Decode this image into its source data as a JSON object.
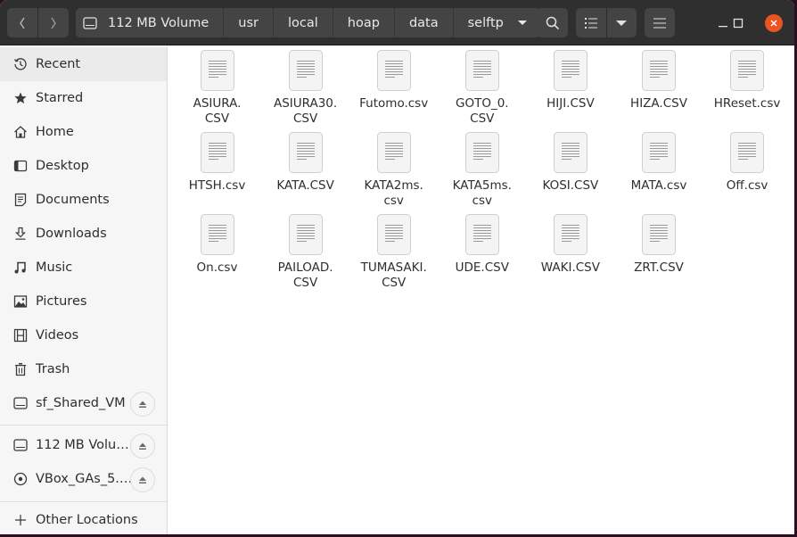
{
  "window": {
    "title": "selftp",
    "controls": {
      "minimize": "minimize",
      "maximize": "maximize",
      "close": "close"
    },
    "accent_color": "#e95420"
  },
  "toolbar": {
    "back_icon": "chevron-left-icon",
    "forward_icon": "chevron-right-icon",
    "breadcrumbs": [
      {
        "label": "112 MB Volume",
        "icon": "drive-icon"
      },
      {
        "label": "usr"
      },
      {
        "label": "local"
      },
      {
        "label": "hoap"
      },
      {
        "label": "data"
      },
      {
        "label": "selftp",
        "has_dropdown": true
      }
    ],
    "search_icon": "search-icon",
    "view_icon": "list-view-icon",
    "view_options_icon": "chevron-down-icon",
    "menu_icon": "hamburger-menu-icon"
  },
  "sidebar": {
    "places": [
      {
        "label": "Recent",
        "icon": "clock-icon",
        "active": true
      },
      {
        "label": "Starred",
        "icon": "star-icon"
      },
      {
        "label": "Home",
        "icon": "home-icon"
      },
      {
        "label": "Desktop",
        "icon": "desktop-icon"
      },
      {
        "label": "Documents",
        "icon": "document-icon"
      },
      {
        "label": "Downloads",
        "icon": "download-icon"
      },
      {
        "label": "Music",
        "icon": "music-icon"
      },
      {
        "label": "Pictures",
        "icon": "picture-icon"
      },
      {
        "label": "Videos",
        "icon": "video-icon"
      },
      {
        "label": "Trash",
        "icon": "trash-icon"
      },
      {
        "label": "sf_Shared_VM",
        "icon": "drive-icon",
        "ejectable": true
      }
    ],
    "devices": [
      {
        "label": "112 MB Volu…",
        "icon": "drive-icon",
        "ejectable": true
      },
      {
        "label": "VBox_GAs_5.…",
        "icon": "disc-icon",
        "ejectable": true
      }
    ],
    "other": {
      "label": "Other Locations",
      "icon": "plus-icon"
    }
  },
  "files": [
    {
      "name": "ASIURA.CSV",
      "display": [
        "ASIURA.",
        "CSV"
      ]
    },
    {
      "name": "ASIURA30.CSV",
      "display": [
        "ASIURA30.",
        "CSV"
      ]
    },
    {
      "name": "Futomo.csv",
      "display": [
        "Futomo.csv"
      ]
    },
    {
      "name": "GOTO_0.CSV",
      "display": [
        "GOTO_0.",
        "CSV"
      ]
    },
    {
      "name": "HIJI.CSV",
      "display": [
        "HIJI.CSV"
      ]
    },
    {
      "name": "HIZA.CSV",
      "display": [
        "HIZA.CSV"
      ]
    },
    {
      "name": "HReset.csv",
      "display": [
        "HReset.csv"
      ]
    },
    {
      "name": "HTSH.csv",
      "display": [
        "HTSH.csv"
      ]
    },
    {
      "name": "KATA.CSV",
      "display": [
        "KATA.CSV"
      ]
    },
    {
      "name": "KATA2ms.csv",
      "display": [
        "KATA2ms.",
        "csv"
      ]
    },
    {
      "name": "KATA5ms.csv",
      "display": [
        "KATA5ms.",
        "csv"
      ]
    },
    {
      "name": "KOSI.CSV",
      "display": [
        "KOSI.CSV"
      ]
    },
    {
      "name": "MATA.csv",
      "display": [
        "MATA.csv"
      ]
    },
    {
      "name": "Off.csv",
      "display": [
        "Off.csv"
      ]
    },
    {
      "name": "On.csv",
      "display": [
        "On.csv"
      ]
    },
    {
      "name": "PAILOAD.CSV",
      "display": [
        "PAILOAD.",
        "CSV"
      ]
    },
    {
      "name": "TUMASAKI.CSV",
      "display": [
        "TUMASAKI.",
        "CSV"
      ]
    },
    {
      "name": "UDE.CSV",
      "display": [
        "UDE.CSV"
      ]
    },
    {
      "name": "WAKI.CSV",
      "display": [
        "WAKI.CSV"
      ]
    },
    {
      "name": "ZRT.CSV",
      "display": [
        "ZRT.CSV"
      ]
    }
  ]
}
